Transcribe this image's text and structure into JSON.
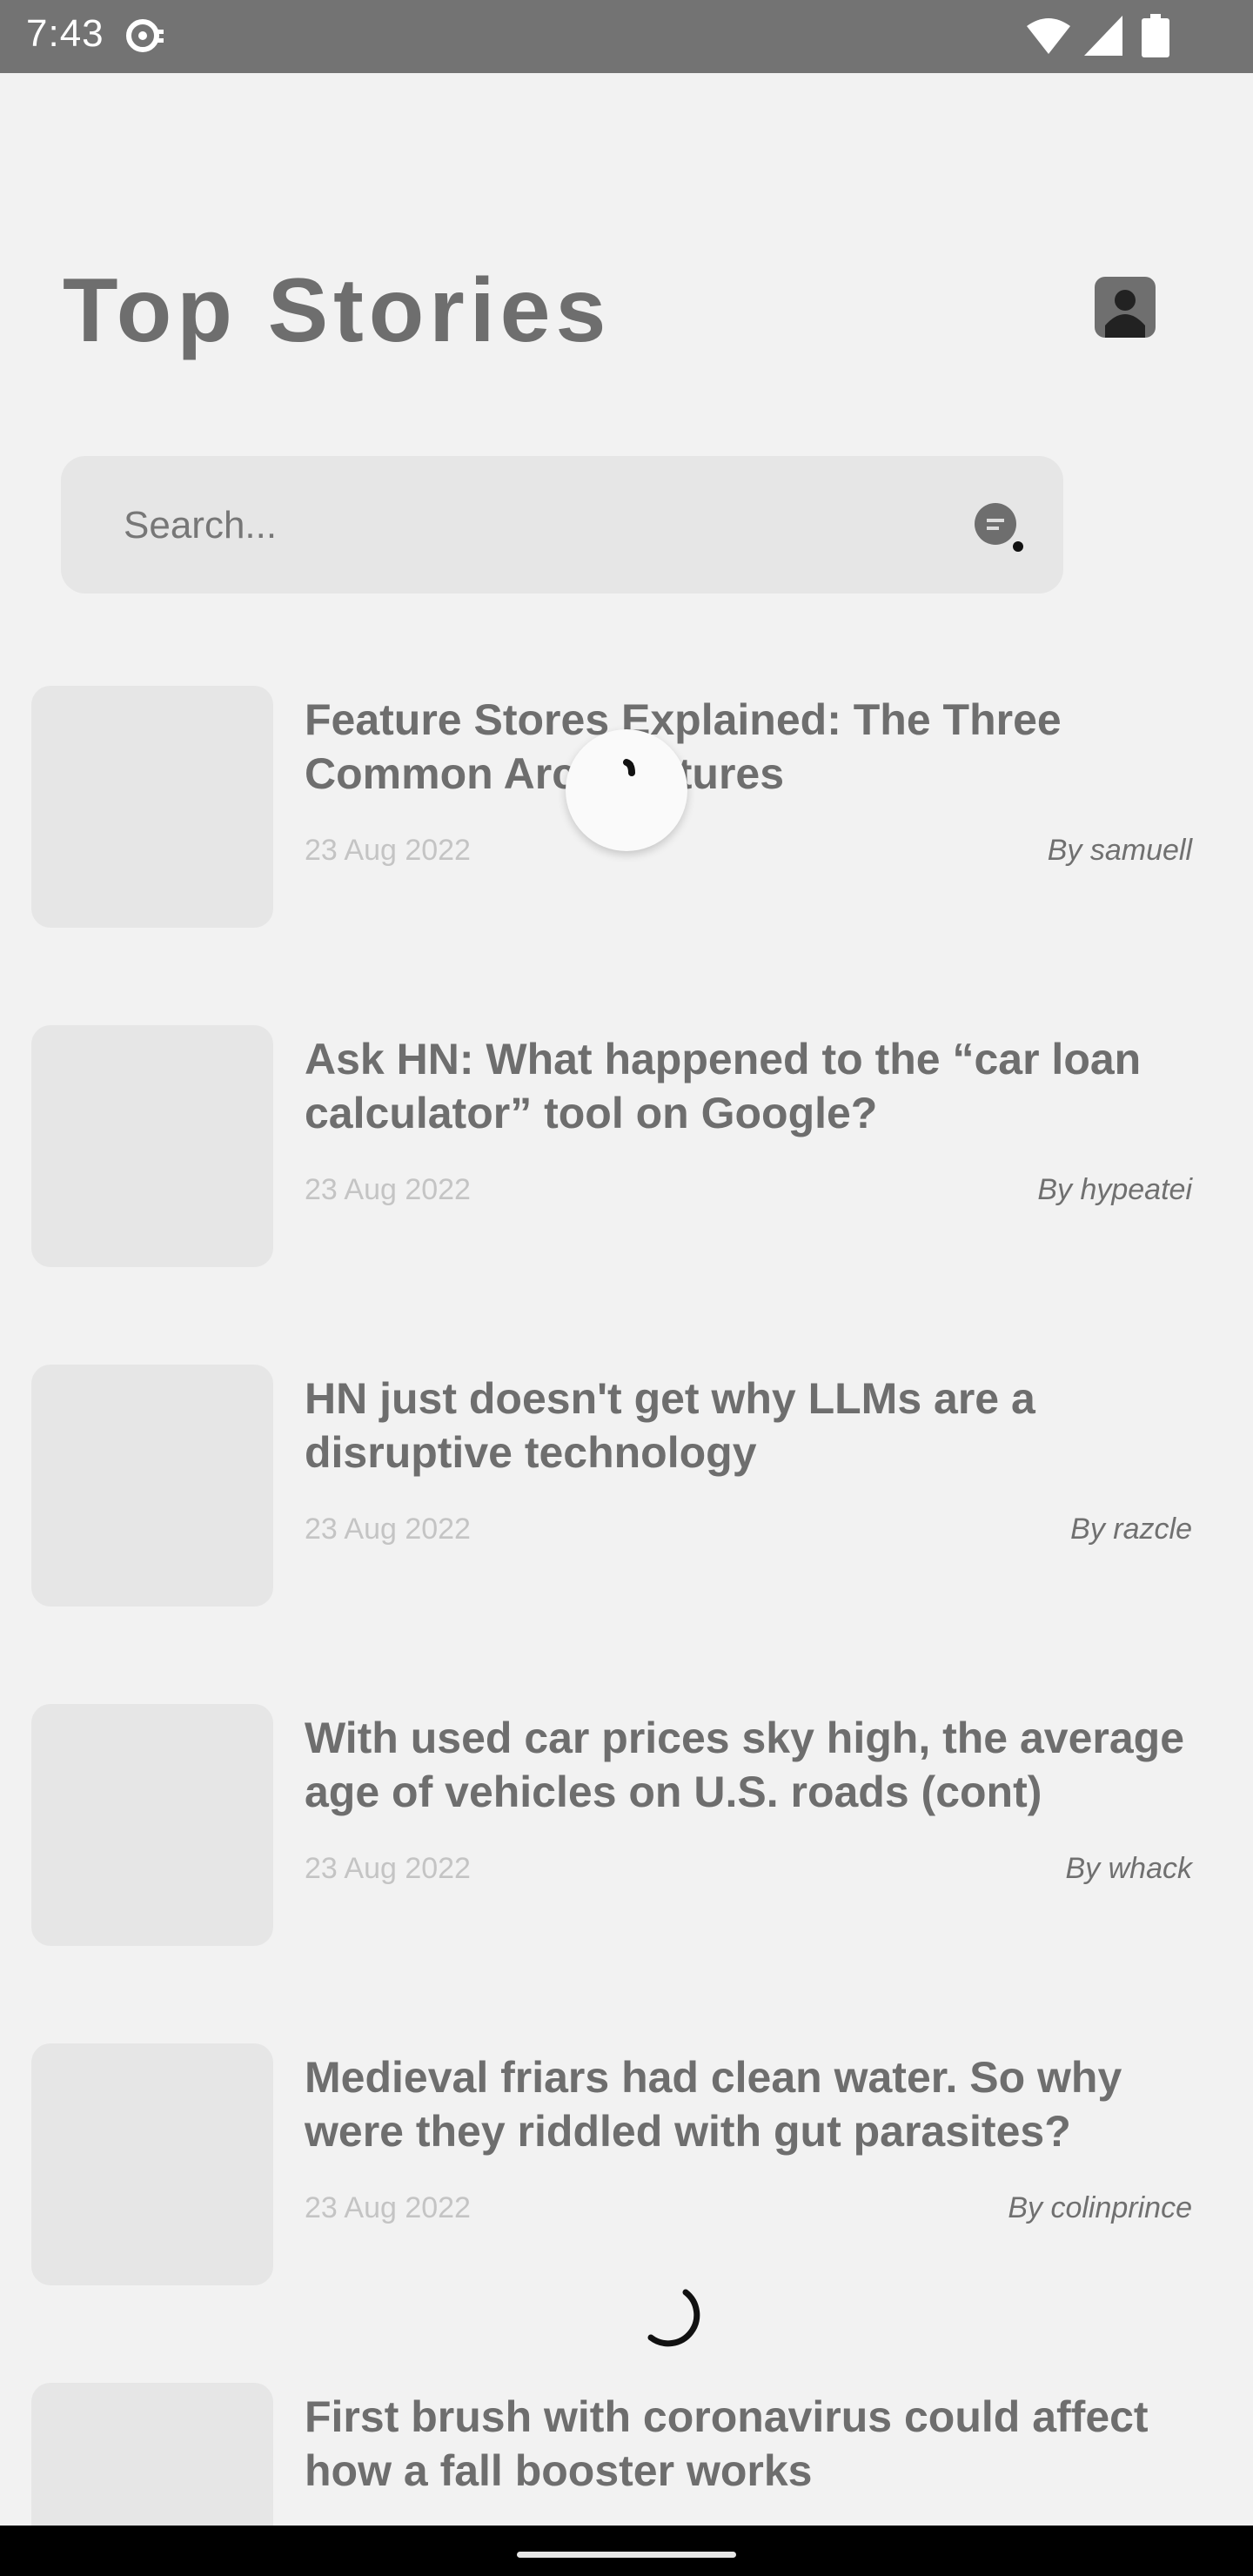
{
  "status_bar": {
    "time": "7:43"
  },
  "header": {
    "title": "Top Stories"
  },
  "search": {
    "placeholder": "Search..."
  },
  "stories": [
    {
      "title": "Feature Stores Explained: The Three Common Architectures",
      "date": "23 Aug 2022",
      "author": "By samuell"
    },
    {
      "title": "Ask HN: What happened to the “car loan calculator” tool on Google?",
      "date": "23 Aug 2022",
      "author": "By hypeatei"
    },
    {
      "title": "HN just doesn't get why LLMs are a disruptive technology",
      "date": "23 Aug 2022",
      "author": "By razcle"
    },
    {
      "title": "With used car prices sky high, the average age of vehicles on U.S. roads (cont)",
      "date": "23 Aug 2022",
      "author": "By whack"
    },
    {
      "title": "Medieval friars had clean water. So why were they riddled with gut parasites?",
      "date": "23 Aug 2022",
      "author": "By colinprince"
    },
    {
      "title": "First brush with coronavirus could affect how a fall booster works",
      "date": "",
      "author": ""
    }
  ],
  "icons": {
    "notification": "notification-icon",
    "wifi": "wifi-icon",
    "signal": "signal-icon",
    "battery": "battery-icon",
    "profile": "profile-icon",
    "filter": "filter-icon",
    "spinner": "loading-spinner-icon"
  },
  "colors": {
    "background": "#f2f2f2",
    "status_bar": "#737373",
    "title_text": "#6e6e6e",
    "placeholder_block": "#e6e6e6",
    "date_text": "#c4c4c4"
  }
}
